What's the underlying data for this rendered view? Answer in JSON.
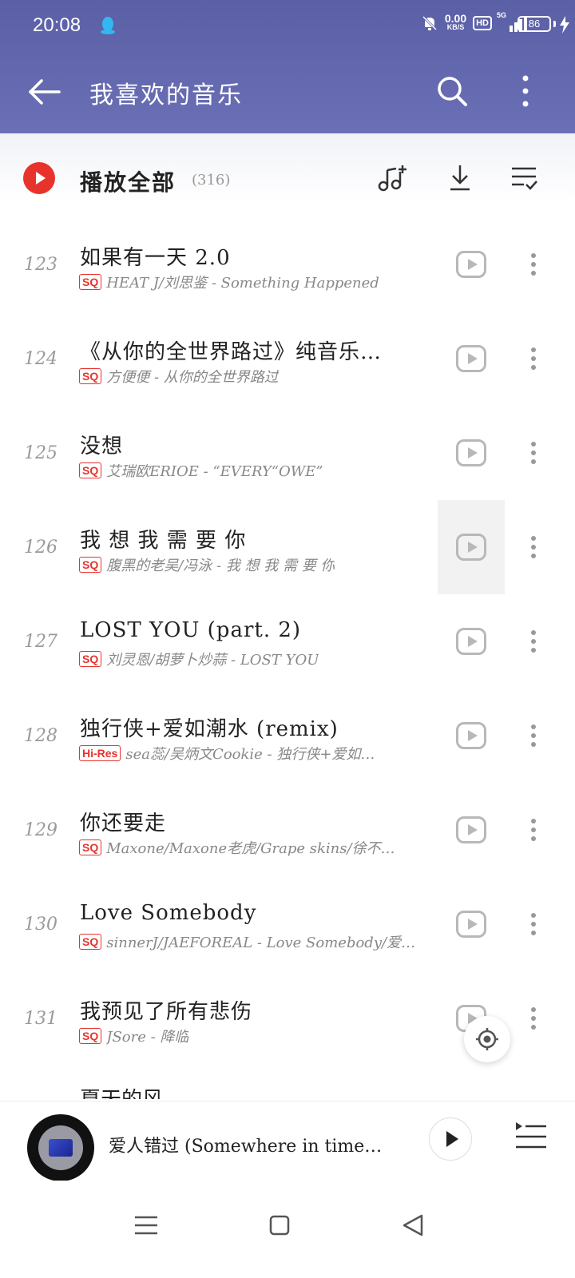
{
  "status_bar": {
    "time": "20:08",
    "net_speed_value": "0.00",
    "net_speed_unit": "KB/S",
    "hd": "HD",
    "network": "5G",
    "battery": "86"
  },
  "header": {
    "title": "我喜欢的音乐",
    "icons": [
      "back-arrow-icon",
      "search-icon",
      "more-vertical-icon"
    ]
  },
  "play_all": {
    "label": "播放全部",
    "count": "(316)",
    "icons": [
      "add-music-icon",
      "download-icon",
      "multi-select-icon"
    ]
  },
  "songs": [
    {
      "index": "123",
      "title": "如果有一天 2.0",
      "quality": "SQ",
      "subtitle": "HEAT J/刘思鉴 - Something Happened"
    },
    {
      "index": "124",
      "title": "《从你的全世界路过》纯音乐…",
      "quality": "SQ",
      "subtitle": "方便便 - 从你的全世界路过"
    },
    {
      "index": "125",
      "title": "没想",
      "quality": "SQ",
      "subtitle": "艾瑞欧ERIOE - “EVERY“OWE”"
    },
    {
      "index": "126",
      "title": "我 想 我 需 要 你",
      "quality": "SQ",
      "subtitle": "腹黑的老吴/冯泳 - 我 想 我 需 要 你"
    },
    {
      "index": "127",
      "title": "LOST YOU (part. 2)",
      "quality": "SQ",
      "subtitle": "刘灵恩/胡萝卜炒蒜 - LOST YOU"
    },
    {
      "index": "128",
      "title": "独行侠+爱如潮水 (remix)",
      "quality": "Hi-Res",
      "subtitle": "sea蕊/吴炳文Cookie - 独行侠+爱如…"
    },
    {
      "index": "129",
      "title": "你还要走",
      "quality": "SQ",
      "subtitle": "Maxone/Maxone老虎/Grape skins/徐不…"
    },
    {
      "index": "130",
      "title": "Love Somebody",
      "quality": "SQ",
      "subtitle": "sinnerJ/JAEFOREAL - Love Somebody/爱…"
    },
    {
      "index": "131",
      "title": "我预见了所有悲伤",
      "quality": "SQ",
      "subtitle": "JSore - 降临"
    }
  ],
  "partial_next_title": "夏天的风",
  "now_playing": {
    "title": "爱人错过 (Somewhere in time…"
  },
  "colors": {
    "header_top": "#5a5fa6",
    "header_bottom": "#6b70b6",
    "accent_red": "#e8332d",
    "muted_gray": "#9a9a9a"
  }
}
